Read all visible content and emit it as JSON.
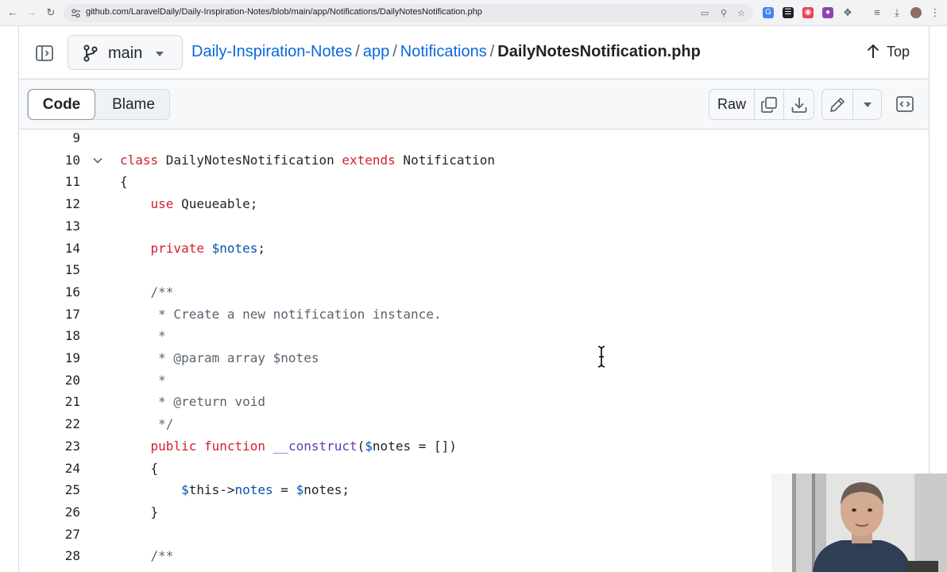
{
  "browser": {
    "url": "github.com/LaravelDaily/Daily-Inspiration-Notes/blob/main/app/Notifications/DailyNotesNotification.php"
  },
  "header": {
    "branch": "main",
    "breadcrumb": {
      "repo": "Daily-Inspiration-Notes",
      "sep1": "/",
      "folder1": "app",
      "sep2": "/",
      "folder2": "Notifications",
      "sep3": "/",
      "file": "DailyNotesNotification.php"
    },
    "top_label": "Top"
  },
  "toolbar": {
    "code_tab": "Code",
    "blame_tab": "Blame",
    "raw_label": "Raw"
  },
  "code": {
    "lines": [
      {
        "num": "9",
        "tokens": []
      },
      {
        "num": "10",
        "tokens": [
          {
            "t": "kw",
            "v": "class"
          },
          {
            "t": "",
            "v": " DailyNotesNotification "
          },
          {
            "t": "kw",
            "v": "extends"
          },
          {
            "t": "",
            "v": " Notification"
          }
        ]
      },
      {
        "num": "11",
        "tokens": [
          {
            "t": "",
            "v": "{"
          }
        ]
      },
      {
        "num": "12",
        "tokens": [
          {
            "t": "",
            "v": "    "
          },
          {
            "t": "kw",
            "v": "use"
          },
          {
            "t": "",
            "v": " Queueable;"
          }
        ]
      },
      {
        "num": "13",
        "tokens": []
      },
      {
        "num": "14",
        "tokens": [
          {
            "t": "",
            "v": "    "
          },
          {
            "t": "kw",
            "v": "private"
          },
          {
            "t": "",
            "v": " "
          },
          {
            "t": "var",
            "v": "$notes"
          },
          {
            "t": "",
            "v": ";"
          }
        ]
      },
      {
        "num": "15",
        "tokens": []
      },
      {
        "num": "16",
        "tokens": [
          {
            "t": "cm",
            "v": "    /**"
          }
        ]
      },
      {
        "num": "17",
        "tokens": [
          {
            "t": "cm",
            "v": "     * Create a new notification instance."
          }
        ]
      },
      {
        "num": "18",
        "tokens": [
          {
            "t": "cm",
            "v": "     *"
          }
        ]
      },
      {
        "num": "19",
        "tokens": [
          {
            "t": "cm",
            "v": "     * @param array $notes"
          }
        ]
      },
      {
        "num": "20",
        "tokens": [
          {
            "t": "cm",
            "v": "     *"
          }
        ]
      },
      {
        "num": "21",
        "tokens": [
          {
            "t": "cm",
            "v": "     * @return void"
          }
        ]
      },
      {
        "num": "22",
        "tokens": [
          {
            "t": "cm",
            "v": "     */"
          }
        ]
      },
      {
        "num": "23",
        "tokens": [
          {
            "t": "",
            "v": "    "
          },
          {
            "t": "kw",
            "v": "public"
          },
          {
            "t": "",
            "v": " "
          },
          {
            "t": "kw",
            "v": "function"
          },
          {
            "t": "",
            "v": " "
          },
          {
            "t": "fn",
            "v": "__construct"
          },
          {
            "t": "",
            "v": "("
          },
          {
            "t": "var",
            "v": "$"
          },
          {
            "t": "",
            "v": "notes = [])"
          }
        ]
      },
      {
        "num": "24",
        "tokens": [
          {
            "t": "",
            "v": "    {"
          }
        ]
      },
      {
        "num": "25",
        "tokens": [
          {
            "t": "",
            "v": "        "
          },
          {
            "t": "var",
            "v": "$"
          },
          {
            "t": "",
            "v": "this->"
          },
          {
            "t": "var",
            "v": "notes"
          },
          {
            "t": "",
            "v": " = "
          },
          {
            "t": "var",
            "v": "$"
          },
          {
            "t": "",
            "v": "notes;"
          }
        ]
      },
      {
        "num": "26",
        "tokens": [
          {
            "t": "",
            "v": "    }"
          }
        ]
      },
      {
        "num": "27",
        "tokens": []
      },
      {
        "num": "28",
        "tokens": [
          {
            "t": "cm",
            "v": "    /**"
          }
        ]
      }
    ]
  },
  "colors": {
    "link": "#0969da",
    "keyword": "#cf222e",
    "variable": "#0550ae",
    "function": "#6639ba",
    "comment": "#59636e"
  }
}
